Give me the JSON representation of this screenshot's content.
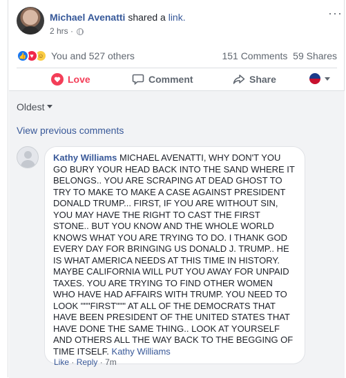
{
  "post": {
    "author": "Michael Avenatti",
    "action": "shared a",
    "link_word": "link.",
    "time": "2 hrs",
    "more": "···"
  },
  "reactions": {
    "summary": "You and 527 others",
    "comments_count": "151 Comments",
    "shares_count": "59 Shares",
    "icons": [
      "like-icon",
      "love-icon",
      "haha-icon"
    ],
    "like_color": "#1877f2",
    "love_color": "#f0284a",
    "haha_color": "#fbcd45"
  },
  "actions": {
    "love": "Love",
    "comment": "Comment",
    "share": "Share",
    "love_color": "#f33e58"
  },
  "comments": {
    "sort_label": "Oldest",
    "view_previous": "View previous comments",
    "items": [
      {
        "author": "Kathy Williams",
        "text": "MICHAEL AVENATTI, WHY DON'T YOU GO BURY YOUR HEAD BACK INTO THE SAND WHERE IT BELONGS.. YOU ARE SCRAPING AT DEAD GHOST TO TRY TO MAKE TO MAKE A CASE AGAINST PRESIDENT DONALD TRUMP... FIRST, IF YOU ARE WITHOUT SIN, YOU MAY HAVE THE RIGHT TO CAST THE FIRST STONE.. BUT YOU KNOW AND THE WHOLE WORLD KNOWS WHAT YOU ARE TRYING TO DO. I THANK GOD EVERY DAY FOR BRINGING US DONALD J. TRUMP.. HE IS WHAT AMERICA NEEDS AT THIS TIME IN HISTORY. MAYBE CALIFORNIA WILL PUT YOU AWAY FOR UNPAID TAXES. YOU ARE TRYING TO FIND OTHER WOMEN WHO HAVE HAD AFFAIRS WITH TRUMP. YOU NEED TO LOOK \"\"\"FIRST\"\"\" AT ALL OF THE DEMOCRATS THAT HAVE BEEN PRESIDENT OF THE UNITED STATES THAT HAVE DONE THE SAME THING.. LOOK AT YOURSELF AND OTHERS ALL THE WAY BACK TO THE BEGGING OF TIME ITSELF.",
        "signature": "Kathy Williams",
        "like": "Like",
        "reply": "Reply",
        "time": "7m"
      }
    ]
  }
}
